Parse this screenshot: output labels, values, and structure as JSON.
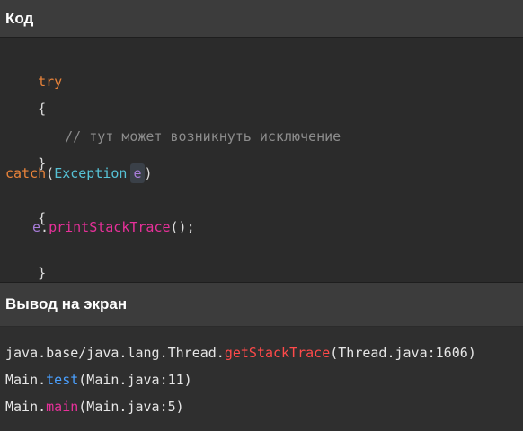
{
  "code_section": {
    "title": "Код",
    "lines": {
      "l1_kw": "try",
      "l2": "{",
      "l3_comment": "// тут может возникнуть исключение",
      "l4": "}",
      "l5_kw": "catch",
      "l5_open": "(",
      "l5_type": "Exception",
      "l5_var": "e",
      "l5_close": ")",
      "l6": "{",
      "l7_var": "e",
      "l7_dot": ".",
      "l7_method": "printStackTrace",
      "l7_tail": "();",
      "l8": "}"
    }
  },
  "output_section": {
    "title": "Вывод на экран",
    "lines": {
      "o1_prefix": "java.base/java.lang.Thread.",
      "o1_method": "getStackTrace",
      "o1_suffix": "(Thread.java:1606)",
      "o2_prefix": "Main.",
      "o2_method": "test",
      "o2_suffix": "(Main.java:11)",
      "o3_prefix": "Main.",
      "o3_method": "main",
      "o3_suffix": "(Main.java:5)"
    }
  },
  "colors": {
    "keyword": "#e8833a",
    "class": "#56c2d6",
    "variable": "#a77cd8",
    "comment": "#8c8c8c",
    "method_red": "#ff4a4a",
    "method_blue": "#4aa0ff",
    "method_magenta": "#e8309a"
  }
}
